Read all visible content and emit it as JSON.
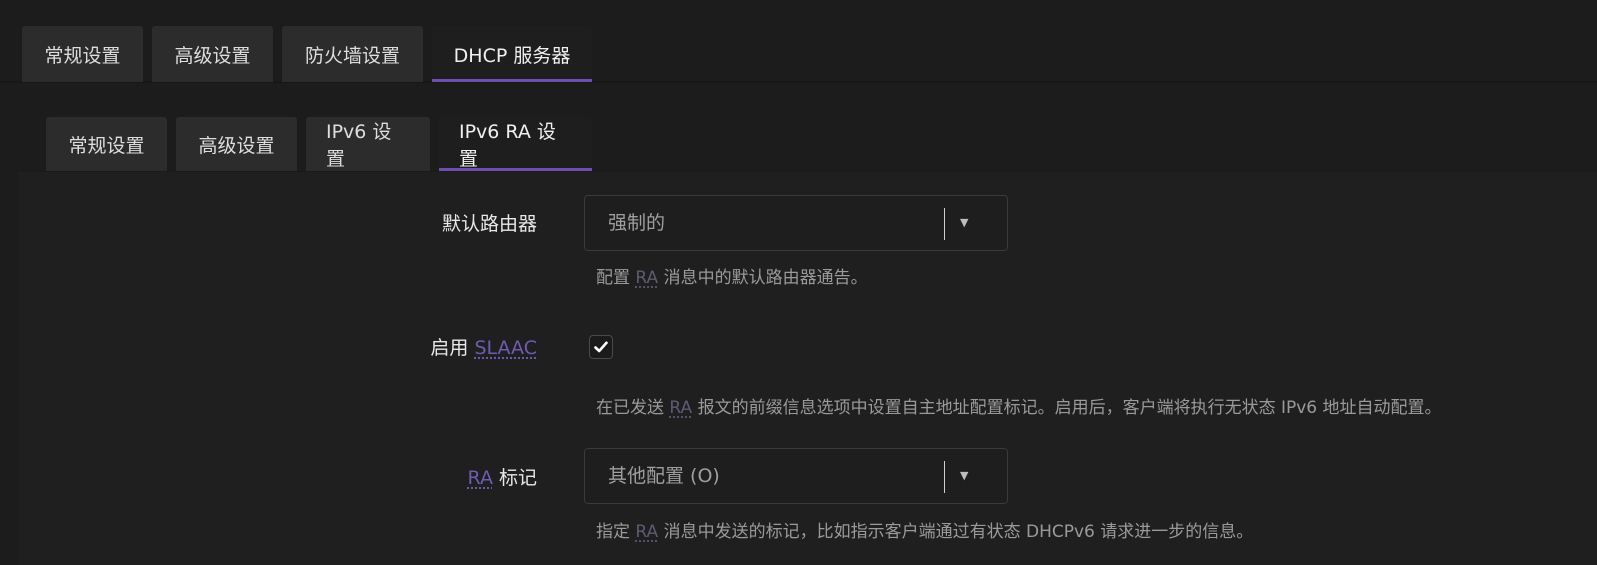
{
  "tabs_top": [
    {
      "label": "常规设置",
      "active": false
    },
    {
      "label": "高级设置",
      "active": false
    },
    {
      "label": "防火墙设置",
      "active": false
    },
    {
      "label": "DHCP 服务器",
      "active": true
    }
  ],
  "tabs_sub": [
    {
      "label": "常规设置",
      "active": false
    },
    {
      "label": "高级设置",
      "active": false
    },
    {
      "label": "IPv6 设置",
      "active": false
    },
    {
      "label": "IPv6 RA 设置",
      "active": true
    }
  ],
  "fields": {
    "default_router": {
      "label": "默认路由器",
      "value": "强制的",
      "help_prefix": "配置 ",
      "help_abbr": "RA",
      "help_suffix": " 消息中的默认路由器通告。"
    },
    "slaac": {
      "label_prefix": "启用 ",
      "label_abbr": "SLAAC",
      "checked": true,
      "help_prefix": "在已发送 ",
      "help_abbr": "RA",
      "help_suffix": " 报文的前缀信息选项中设置自主地址配置标记。启用后，客户端将执行无状态 IPv6 地址自动配置。"
    },
    "ra_flags": {
      "label_abbr": "RA",
      "label_suffix": " 标记",
      "value": "其他配置 (O)",
      "help_prefix": "指定 ",
      "help_abbr": "RA",
      "help_suffix": " 消息中发送的标记，比如指示客户端通过有状态 DHCPv6 请求进一步的信息。"
    }
  },
  "colors": {
    "accent": "#6e4fb0",
    "background": "#1c1c1c",
    "tab_bg": "#2c2c2c"
  },
  "icons": {
    "dropdown": "caret-down-icon",
    "check": "checkmark-icon"
  }
}
